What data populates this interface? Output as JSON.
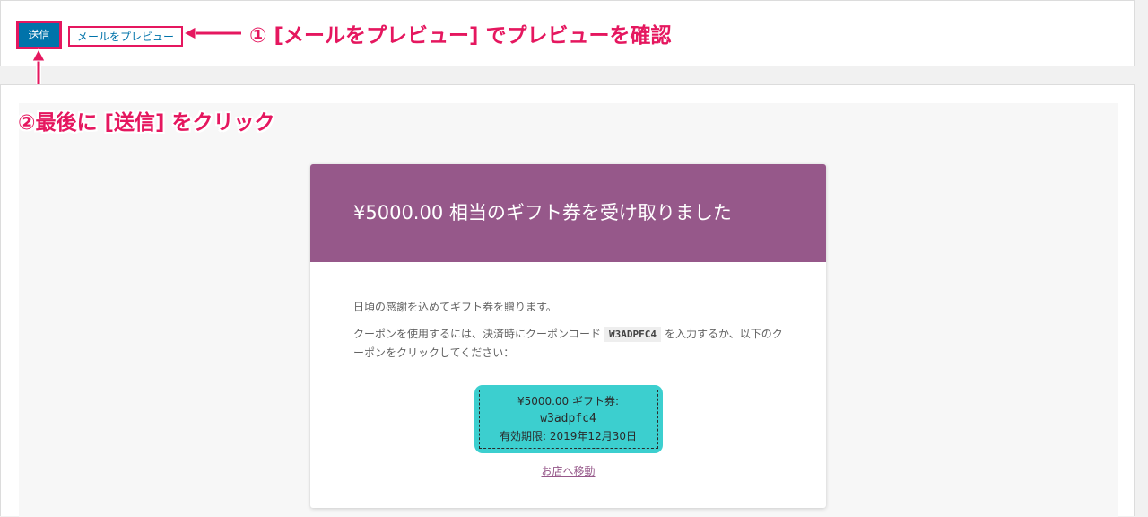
{
  "toolbar": {
    "send_label": "送信",
    "preview_label": "メールをプレビュー"
  },
  "annotations": {
    "step1": "① [メールをプレビュー] でプレビューを確認",
    "step2": "②最後に [送信] をクリック",
    "color": "#e5175f"
  },
  "email": {
    "heading": "¥5000.00 相当のギフト券を受け取りました",
    "intro": "日頃の感謝を込めてギフト券を贈ります。",
    "instruction_before": "クーポンを使用するには、決済時にクーポンコード",
    "coupon_code_upper": "W3ADPFC4",
    "instruction_after": "を入力するか、以下のクーポンをクリックしてください：",
    "coupon": {
      "title": "¥5000.00 ギフト券:",
      "code": "w3adpfc4",
      "expiry": "有効期限: 2019年12月30日"
    },
    "shop_link": "お店へ移動"
  },
  "colors": {
    "primary_button": "#0073aa",
    "email_header": "#96588a",
    "coupon_bg": "#3ccfcf"
  }
}
